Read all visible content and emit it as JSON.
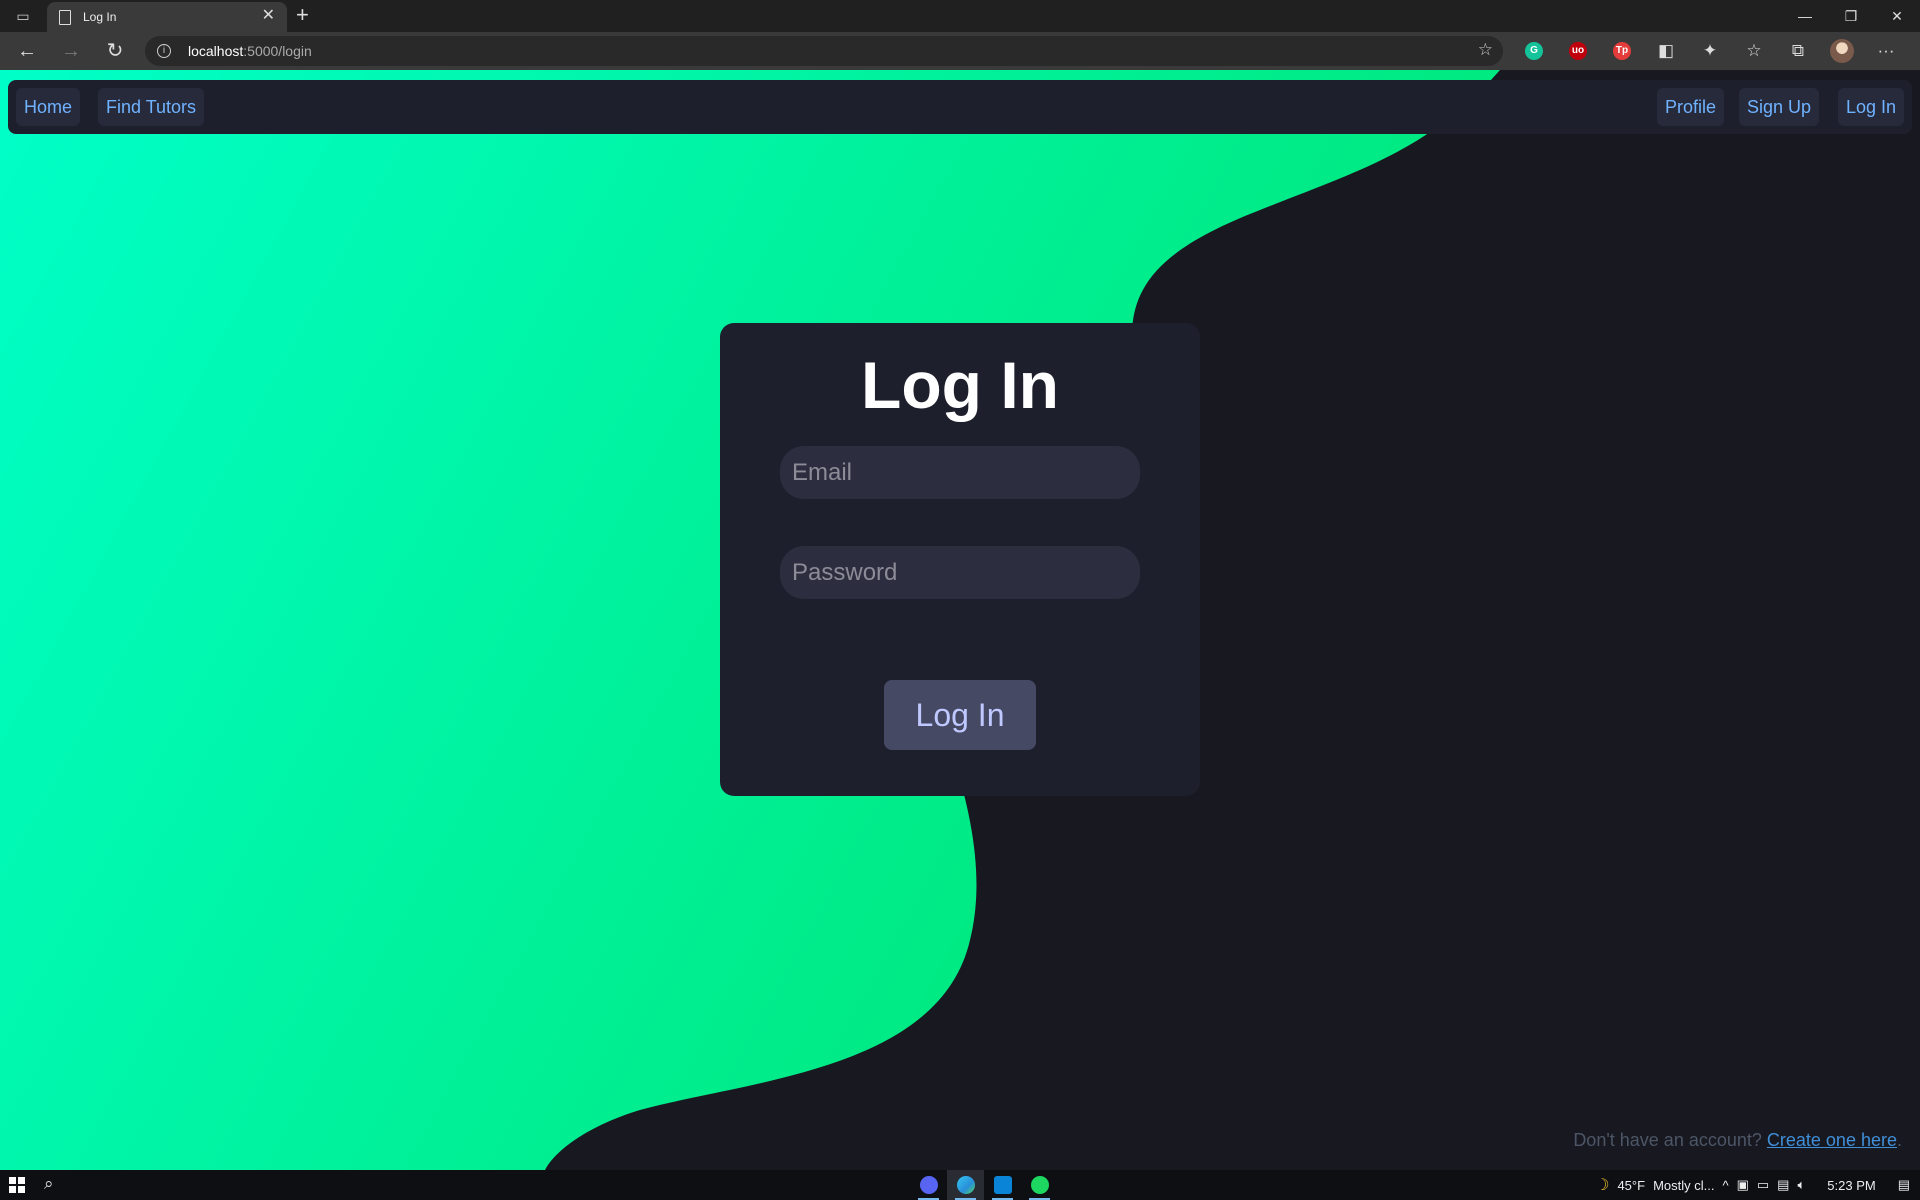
{
  "browser": {
    "tab_title": "Log In",
    "url_host": "localhost",
    "url_rest": ":5000/login",
    "extensions": [
      {
        "name": "grammarly-icon",
        "label": "G",
        "color": "#15c39a"
      },
      {
        "name": "ublock-icon",
        "label": "uo",
        "color": "#c0000c"
      },
      {
        "name": "tp-icon",
        "label": "Tp",
        "color": "#e43b3b"
      }
    ]
  },
  "nav": {
    "home": "Home",
    "find_tutors": "Find Tutors",
    "profile": "Profile",
    "sign_up": "Sign Up",
    "log_in": "Log In"
  },
  "login": {
    "title": "Log In",
    "email_placeholder": "Email",
    "password_placeholder": "Password",
    "submit_label": "Log In"
  },
  "footer": {
    "prompt": "Don't have an account? ",
    "link": "Create one here",
    "end": "."
  },
  "taskbar": {
    "weather": "45°F",
    "weather_text": "Mostly cl...",
    "time": "5:23 PM"
  },
  "colors": {
    "gradient_start": "#00ffc8",
    "gradient_end": "#00e676",
    "page_bg": "#181820",
    "card_bg": "#1e1f2c",
    "link": "#6fb2ff"
  }
}
